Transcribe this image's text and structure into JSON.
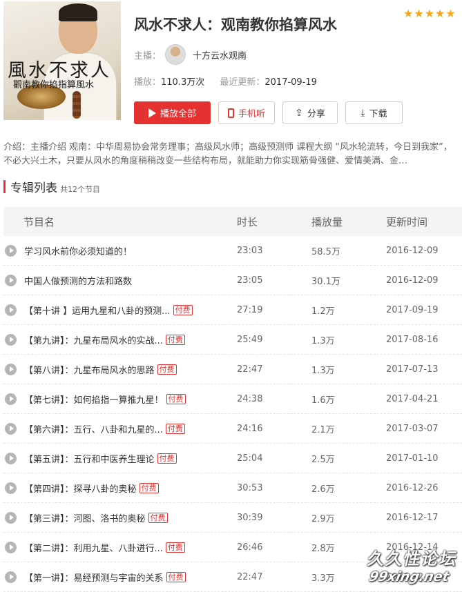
{
  "album": {
    "cover": {
      "title": "風水不求人",
      "subtitle": "觀南教你掐指算風水"
    },
    "title": "风水不求人：观南教你掐算风水",
    "rating_stars": 5,
    "host_label": "主播：",
    "host_name": "十方云水观南",
    "plays_label": "播放：",
    "plays_value": "110.3万次",
    "updated_label": "最近更新：",
    "updated_value": "2017-09-19",
    "buttons": {
      "play_all": "播放全部",
      "mobile": "手机听",
      "share": "分享",
      "download": "下载"
    },
    "intro": "介绍：主播介绍 观南：中华周易协会常务理事；高级风水师；高级预测师 课程大纲 “风水轮流转，今日到我家”，不必大兴土木，只要从风水的角度稍稍改变一些结构布局，就能助力你实现筋骨强健、爱情美满、金…"
  },
  "list": {
    "title": "专辑列表",
    "count": "共12个节目",
    "headers": {
      "name": "节目名",
      "duration": "时长",
      "plays": "播放量",
      "updated": "更新时间"
    },
    "paid_label": "付费",
    "rows": [
      {
        "name": "学习风水前你必须知道的！",
        "paid": false,
        "duration": "23:03",
        "plays": "58.5万",
        "date": "2016-12-09"
      },
      {
        "name": "中国人做预测的方法和路数",
        "paid": false,
        "duration": "23:05",
        "plays": "30.1万",
        "date": "2016-12-09"
      },
      {
        "name": "【第十讲 】运用九星和八卦的预测...",
        "paid": true,
        "duration": "27:19",
        "plays": "1.2万",
        "date": "2017-09-19"
      },
      {
        "name": "【第九讲】：九星布局风水的实战...",
        "paid": true,
        "duration": "25:49",
        "plays": "1.3万",
        "date": "2017-08-16"
      },
      {
        "name": "【第八讲】：九星布局风水的思路",
        "paid": true,
        "duration": "22:47",
        "plays": "1.3万",
        "date": "2017-07-13"
      },
      {
        "name": "【第七讲】：如何掐指一算推九星！",
        "paid": true,
        "duration": "24:38",
        "plays": "1.6万",
        "date": "2017-04-21"
      },
      {
        "name": "【第六讲】：五行、八卦和九星的...",
        "paid": true,
        "duration": "24:16",
        "plays": "2.1万",
        "date": "2017-03-07"
      },
      {
        "name": "【第五讲】：五行和中医养生理论",
        "paid": true,
        "duration": "25:04",
        "plays": "2.5万",
        "date": "2017-01-10"
      },
      {
        "name": "【第四讲】：探寻八卦的奥秘",
        "paid": true,
        "duration": "30:53",
        "plays": "2.6万",
        "date": "2016-12-26"
      },
      {
        "name": "【第三讲】：河图、洛书的奥秘",
        "paid": true,
        "duration": "30:39",
        "plays": "2.9万",
        "date": "2016-12-17"
      },
      {
        "name": "【第二讲】：利用九星、八卦进行...",
        "paid": true,
        "duration": "26:46",
        "plays": "2.8万",
        "date": "2016-12-14"
      },
      {
        "name": "【第一讲】：易经预测与宇宙的关系",
        "paid": true,
        "duration": "22:47",
        "plays": "3.3万",
        "date": "2016-12-..."
      }
    ]
  },
  "watermark": {
    "line1": "久久性论坛",
    "line2": "99xing.net"
  }
}
